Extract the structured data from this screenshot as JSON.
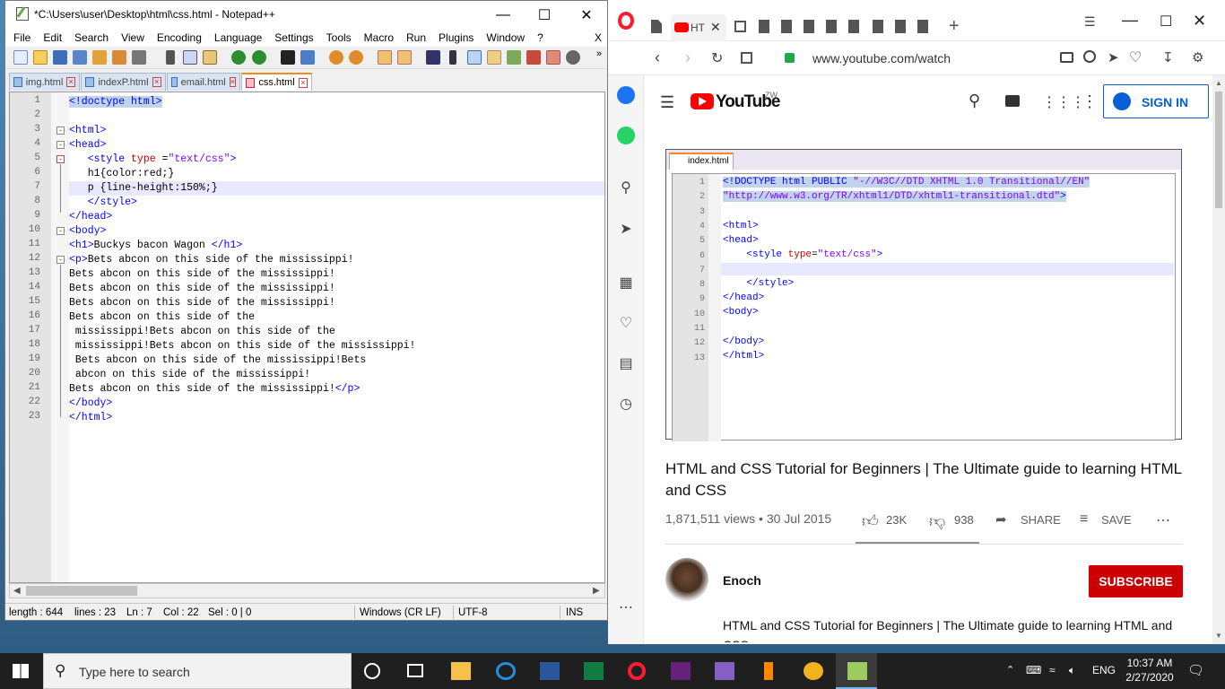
{
  "colors": {
    "opera_red": "#ff1b2d",
    "youtube_red": "#ff0000",
    "subscribe_bg": "#cc0000",
    "sign_in_blue": "#065fd4",
    "npp_tab_active": "#f28a1c"
  },
  "npp": {
    "title": "*C:\\Users\\user\\Desktop\\html\\css.html - Notepad++",
    "menu": [
      "File",
      "Edit",
      "Search",
      "View",
      "Encoding",
      "Language",
      "Settings",
      "Tools",
      "Macro",
      "Run",
      "Plugins",
      "Window",
      "?"
    ],
    "menu_close": "X",
    "tabs": [
      {
        "label": "img.html"
      },
      {
        "label": "indexP.html"
      },
      {
        "label": "email.html"
      },
      {
        "label": "css.html"
      }
    ],
    "line_numbers": [
      "1",
      "2",
      "3",
      "4",
      "5",
      "6",
      "7",
      "8",
      "9",
      "10",
      "11",
      "12",
      "13",
      "14",
      "15",
      "16",
      "17",
      "18",
      "19",
      "20",
      "21",
      "22",
      "23"
    ],
    "status": {
      "length": "length : 644",
      "lines": "lines : 23",
      "ln": "Ln : 7",
      "col": "Col : 22",
      "sel": "Sel : 0 | 0",
      "eol": "Windows (CR LF)",
      "enc": "UTF-8",
      "ins": "INS"
    }
  },
  "opera": {
    "tab_active": "HT",
    "url": "www.youtube.com/watch",
    "yt": {
      "logo": "YouTube",
      "region": "ZW",
      "sign_in": "SIGN IN",
      "video_tab": "index.html",
      "video_line_numbers": [
        "1",
        "2",
        "3",
        "4",
        "5",
        "6",
        "7",
        "8",
        "9",
        "10",
        "11",
        "12",
        "13"
      ],
      "video_title": "HTML and CSS Tutorial for Beginners | The Ultimate guide to learning HTML and CSS",
      "views": "1,871,511 views • 30 Jul 2015",
      "likes": "23K",
      "dislikes": "938",
      "share": "SHARE",
      "save": "SAVE",
      "channel": "Enoch",
      "subscribe": "SUBSCRIBE",
      "description": "HTML and CSS Tutorial for Beginners | The Ultimate guide to learning HTML and CSS"
    }
  },
  "taskbar": {
    "search_placeholder": "Type here to search",
    "lang": "ENG",
    "time": "10:37 AM",
    "date": "2/27/2020"
  }
}
